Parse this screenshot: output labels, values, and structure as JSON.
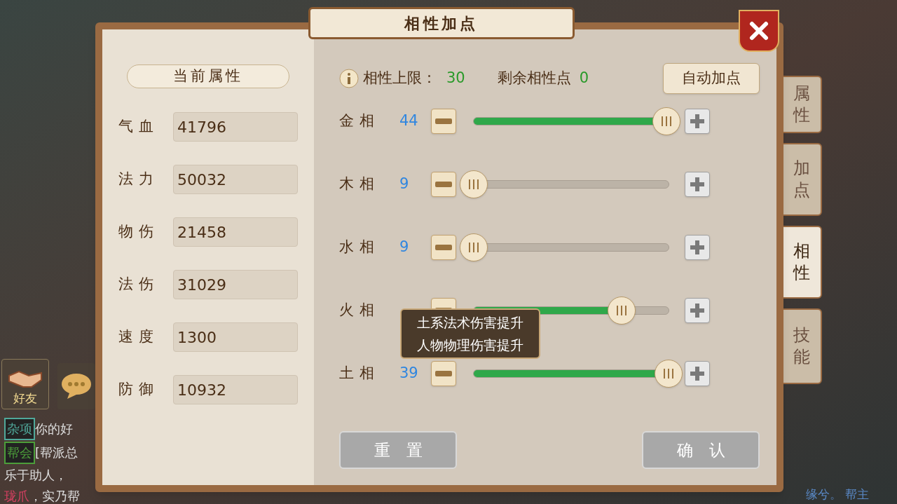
{
  "title": "相性加点",
  "attributes": {
    "header": "当前属性",
    "rows": [
      {
        "label": "气血",
        "value": "41796"
      },
      {
        "label": "法力",
        "value": "50032"
      },
      {
        "label": "物伤",
        "value": "21458"
      },
      {
        "label": "法伤",
        "value": "31029"
      },
      {
        "label": "速度",
        "value": "1300"
      },
      {
        "label": "防御",
        "value": "10932"
      }
    ]
  },
  "affinity": {
    "cap_label": "相性上限：",
    "cap_value": "30",
    "remaining_label": "剩余相性点",
    "remaining_value": "0",
    "auto_button": "自动加点",
    "sliders": [
      {
        "label": "金相",
        "value": "44",
        "level": 0.99
      },
      {
        "label": "木相",
        "value": "9",
        "level": 0
      },
      {
        "label": "水相",
        "value": "9",
        "level": 0
      },
      {
        "label": "火相",
        "level": 0.76
      },
      {
        "label": "土相",
        "value": "39",
        "level": 1
      }
    ]
  },
  "tooltip": {
    "lines": [
      "土系法术伤害提升",
      "人物物理伤害提升"
    ]
  },
  "buttons": {
    "reset": "重置",
    "confirm": "确认"
  },
  "side_tabs": [
    {
      "label": "属性",
      "selected": false
    },
    {
      "label": "加点",
      "selected": false
    },
    {
      "label": "相性",
      "selected": true
    },
    {
      "label": "技能",
      "selected": false
    }
  ],
  "hud": {
    "friend_button": "好友",
    "chat": [
      {
        "tag": "杂项",
        "color": "#4fa89a",
        "text": "你的好"
      },
      {
        "tag": "帮会",
        "color": "#4c9e3a",
        "text": "[帮派总"
      },
      {
        "text": "乐于助人，"
      },
      {
        "highlight": "珑爪",
        "text": "，实乃帮"
      }
    ],
    "player_name": "缘兮。 帮主"
  }
}
